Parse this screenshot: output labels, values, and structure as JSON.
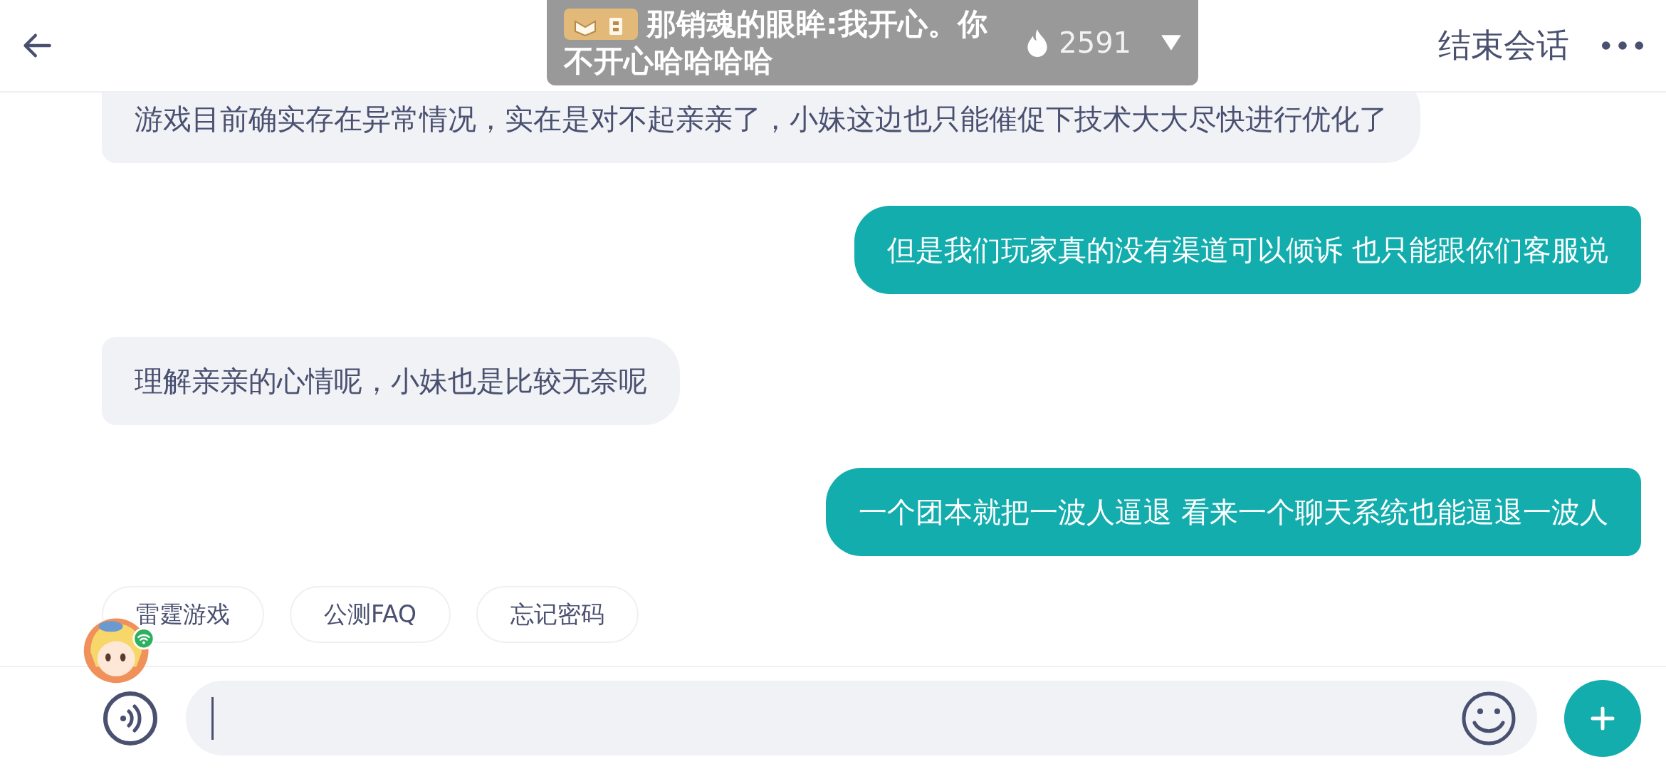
{
  "header": {
    "end_button": "结束会话"
  },
  "live_overlay": {
    "message_lines": [
      "那销魂的眼眸:我开心。你",
      "不开心哈哈哈哈"
    ],
    "count": "2591"
  },
  "messages": [
    {
      "kind": "agent",
      "text": "游戏目前确实存在异常情况，实在是对不起亲亲了，小妹这边也只能催促下技术大大尽快进行优化了"
    },
    {
      "kind": "user",
      "text": "但是我们玩家真的没有渠道可以倾诉 也只能跟你们客服说"
    },
    {
      "kind": "agent",
      "text": "理解亲亲的心情呢，小妹也是比较无奈呢"
    },
    {
      "kind": "user",
      "text": "一个团本就把一波人逼退 看来一个聊天系统也能逼退一波人"
    }
  ],
  "quick_replies": [
    "雷霆游戏",
    "公测FAQ",
    "忘记密码"
  ]
}
